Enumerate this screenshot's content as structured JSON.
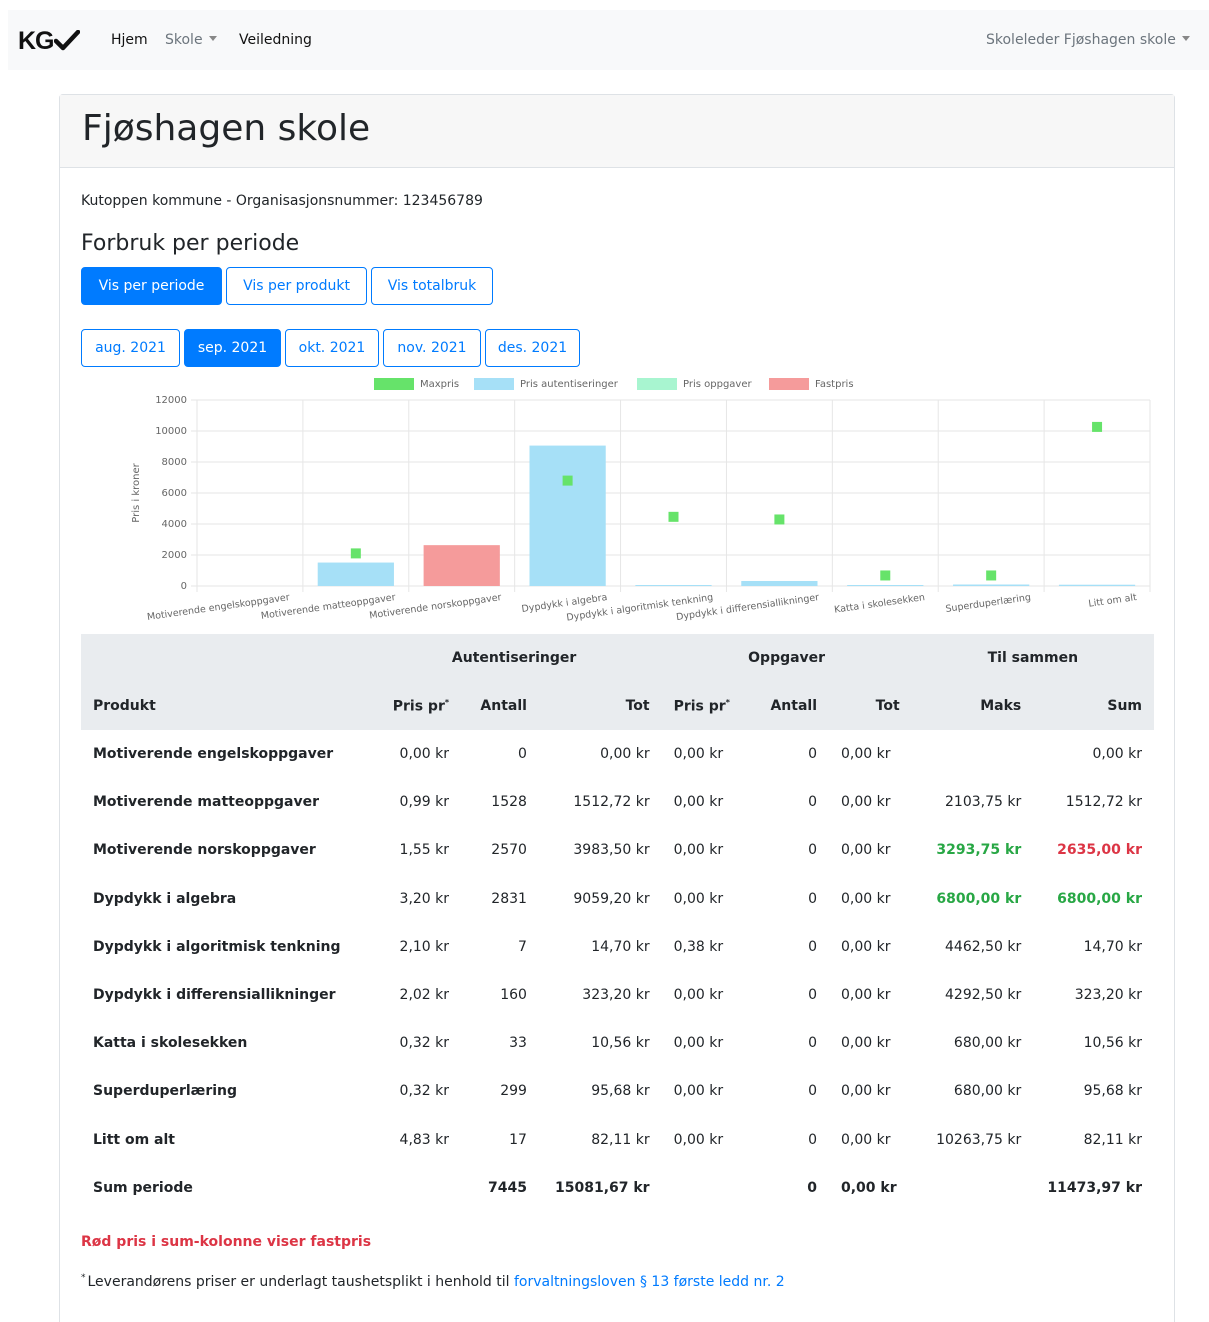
{
  "nav": {
    "brand": "KG",
    "home": "Hjem",
    "skole": "Skole",
    "veiledning": "Veiledning",
    "user": "Skoleleder Fjøshagen skole"
  },
  "page": {
    "title": "Fjøshagen skole",
    "org_line": "Kutoppen kommune - Organisasjonsnummer: 123456789",
    "section_title": "Forbruk per periode"
  },
  "view_buttons": [
    "Vis per periode",
    "Vis per produkt",
    "Vis totalbruk"
  ],
  "active_view": "Vis per periode",
  "periods": [
    "aug. 2021",
    "sep. 2021",
    "okt. 2021",
    "nov. 2021",
    "des. 2021"
  ],
  "active_period": "sep. 2021",
  "colors": {
    "primary": "#007bff",
    "maxpris": "#66e36a",
    "autentiseringer": "#a6e0f7",
    "oppgaver": "#a8f5d0",
    "fastpris": "#f59b9b",
    "green": "#28a745",
    "red": "#dc3545"
  },
  "chart_data": {
    "type": "bar",
    "ylabel": "Pris i kroner",
    "ylim": [
      0,
      12000
    ],
    "yticks": [
      0,
      2000,
      4000,
      6000,
      8000,
      10000,
      12000
    ],
    "categories": [
      "Motiverende engelskoppgaver",
      "Motiverende matteoppgaver",
      "Motiverende norskoppgaver",
      "Dypdykk i algebra",
      "Dypdykk i algoritmisk tenkning",
      "Dypdykk i differensiallikninger",
      "Katta i skolesekken",
      "Superduperlæring",
      "Litt om alt"
    ],
    "series": [
      {
        "name": "Maxpris",
        "kind": "point",
        "values": [
          null,
          2103.75,
          null,
          6800,
          4462.5,
          4292.5,
          680,
          680,
          10263.75
        ]
      },
      {
        "name": "Pris autentiseringer",
        "kind": "bar",
        "values": [
          0,
          1512.72,
          0,
          9059.2,
          14.7,
          323.2,
          10.56,
          95.68,
          82.11
        ]
      },
      {
        "name": "Pris oppgaver",
        "kind": "bar",
        "values": [
          0,
          0,
          0,
          0,
          0,
          0,
          0,
          0,
          0
        ]
      },
      {
        "name": "Fastpris",
        "kind": "bar",
        "values": [
          0,
          0,
          2635,
          0,
          0,
          0,
          0,
          0,
          0
        ]
      }
    ],
    "legend_position": "top",
    "grid": true
  },
  "table": {
    "group_headers": [
      "Autentiseringer",
      "Oppgaver",
      "Til sammen"
    ],
    "columns": [
      "Produkt",
      "Pris pr",
      "Antall",
      "Tot",
      "Pris pr",
      "Antall",
      "Tot",
      "Maks",
      "Sum"
    ],
    "rows": [
      {
        "produkt": "Motiverende engelskoppgaver",
        "a_pris": "0,00 kr",
        "a_antall": "0",
        "a_tot": "0,00 kr",
        "o_pris": "0,00 kr",
        "o_antall": "0",
        "o_tot": "0,00 kr",
        "maks": "",
        "sum": "0,00 kr",
        "maks_class": "",
        "sum_class": ""
      },
      {
        "produkt": "Motiverende matteoppgaver",
        "a_pris": "0,99 kr",
        "a_antall": "1528",
        "a_tot": "1512,72 kr",
        "o_pris": "0,00 kr",
        "o_antall": "0",
        "o_tot": "0,00 kr",
        "maks": "2103,75 kr",
        "sum": "1512,72 kr",
        "maks_class": "",
        "sum_class": ""
      },
      {
        "produkt": "Motiverende norskoppgaver",
        "a_pris": "1,55 kr",
        "a_antall": "2570",
        "a_tot": "3983,50 kr",
        "o_pris": "0,00 kr",
        "o_antall": "0",
        "o_tot": "0,00 kr",
        "maks": "3293,75 kr",
        "sum": "2635,00 kr",
        "maks_class": "green",
        "sum_class": "red"
      },
      {
        "produkt": "Dypdykk i algebra",
        "a_pris": "3,20 kr",
        "a_antall": "2831",
        "a_tot": "9059,20 kr",
        "o_pris": "0,00 kr",
        "o_antall": "0",
        "o_tot": "0,00 kr",
        "maks": "6800,00 kr",
        "sum": "6800,00 kr",
        "maks_class": "green",
        "sum_class": "green"
      },
      {
        "produkt": "Dypdykk i algoritmisk tenkning",
        "a_pris": "2,10 kr",
        "a_antall": "7",
        "a_tot": "14,70 kr",
        "o_pris": "0,38 kr",
        "o_antall": "0",
        "o_tot": "0,00 kr",
        "maks": "4462,50 kr",
        "sum": "14,70 kr",
        "maks_class": "",
        "sum_class": ""
      },
      {
        "produkt": "Dypdykk i differensiallikninger",
        "a_pris": "2,02 kr",
        "a_antall": "160",
        "a_tot": "323,20 kr",
        "o_pris": "0,00 kr",
        "o_antall": "0",
        "o_tot": "0,00 kr",
        "maks": "4292,50 kr",
        "sum": "323,20 kr",
        "maks_class": "",
        "sum_class": ""
      },
      {
        "produkt": "Katta i skolesekken",
        "a_pris": "0,32 kr",
        "a_antall": "33",
        "a_tot": "10,56 kr",
        "o_pris": "0,00 kr",
        "o_antall": "0",
        "o_tot": "0,00 kr",
        "maks": "680,00 kr",
        "sum": "10,56 kr",
        "maks_class": "",
        "sum_class": ""
      },
      {
        "produkt": "Superduperlæring",
        "a_pris": "0,32 kr",
        "a_antall": "299",
        "a_tot": "95,68 kr",
        "o_pris": "0,00 kr",
        "o_antall": "0",
        "o_tot": "0,00 kr",
        "maks": "680,00 kr",
        "sum": "95,68 kr",
        "maks_class": "",
        "sum_class": ""
      },
      {
        "produkt": "Litt om alt",
        "a_pris": "4,83 kr",
        "a_antall": "17",
        "a_tot": "82,11 kr",
        "o_pris": "0,00 kr",
        "o_antall": "0",
        "o_tot": "0,00 kr",
        "maks": "10263,75 kr",
        "sum": "82,11 kr",
        "maks_class": "",
        "sum_class": ""
      }
    ],
    "sum_row": {
      "label": "Sum periode",
      "a_antall": "7445",
      "a_tot": "15081,67 kr",
      "o_antall": "0",
      "o_tot": "0,00 kr",
      "sum": "11473,97 kr"
    }
  },
  "notes": {
    "red_note": "Rød pris i sum-kolonne viser fastpris",
    "footnote_marker": "*",
    "footnote_text": "Leverandørens priser er underlagt taushetsplikt i henhold til",
    "footnote_link": "forvaltningsloven § 13 første ledd nr. 2"
  }
}
